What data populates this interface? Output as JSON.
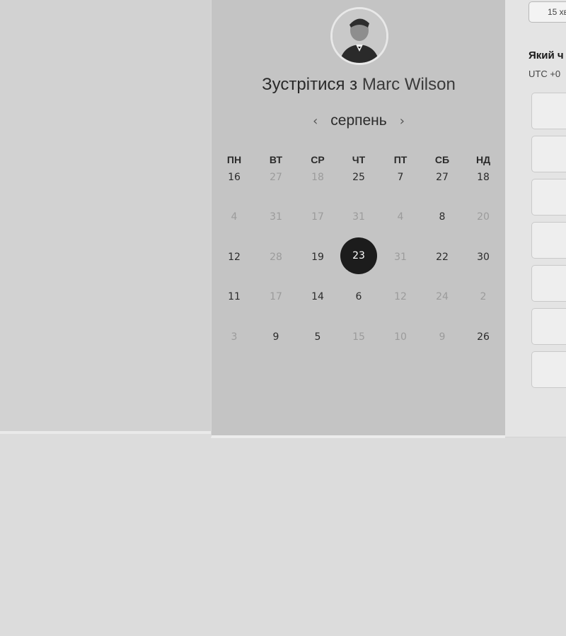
{
  "meeting": {
    "prefix": "Зустрітися з",
    "host_name": "Marc Wilson"
  },
  "calendar": {
    "month": "серпень",
    "prev_icon": "chevron-left-icon",
    "next_icon": "chevron-right-icon",
    "weekdays": [
      "ПН",
      "ВТ",
      "СР",
      "ЧТ",
      "ПТ",
      "СБ",
      "НД"
    ],
    "rows": [
      [
        {
          "d": "16",
          "a": true
        },
        {
          "d": "27",
          "a": false
        },
        {
          "d": "18",
          "a": false
        },
        {
          "d": "25",
          "a": true
        },
        {
          "d": "7",
          "a": true
        },
        {
          "d": "27",
          "a": true
        },
        {
          "d": "18",
          "a": true
        }
      ],
      [
        {
          "d": "4",
          "a": false
        },
        {
          "d": "31",
          "a": false
        },
        {
          "d": "17",
          "a": false
        },
        {
          "d": "31",
          "a": false
        },
        {
          "d": "4",
          "a": false
        },
        {
          "d": "8",
          "a": true
        },
        {
          "d": "20",
          "a": false
        }
      ],
      [
        {
          "d": "12",
          "a": true
        },
        {
          "d": "28",
          "a": false
        },
        {
          "d": "19",
          "a": true
        },
        {
          "d": "23",
          "a": true,
          "selected": true
        },
        {
          "d": "31",
          "a": false
        },
        {
          "d": "22",
          "a": true
        },
        {
          "d": "30",
          "a": true
        }
      ],
      [
        {
          "d": "11",
          "a": true
        },
        {
          "d": "17",
          "a": false
        },
        {
          "d": "14",
          "a": true
        },
        {
          "d": "6",
          "a": true
        },
        {
          "d": "12",
          "a": false
        },
        {
          "d": "24",
          "a": false
        },
        {
          "d": "2",
          "a": false
        }
      ],
      [
        {
          "d": "3",
          "a": false
        },
        {
          "d": "9",
          "a": true
        },
        {
          "d": "5",
          "a": true
        },
        {
          "d": "15",
          "a": false
        },
        {
          "d": "10",
          "a": false
        },
        {
          "d": "9",
          "a": false
        },
        {
          "d": "26",
          "a": true
        }
      ]
    ]
  },
  "booking": {
    "duration": "15 хв",
    "question": "Який ч",
    "timezone": "UTC +0",
    "slot_count": 7
  },
  "colors": {
    "selected_day_bg": "#1c1c1c",
    "active_day_text": "#2b2b2b",
    "inactive_day_text": "#9b9b9b"
  }
}
